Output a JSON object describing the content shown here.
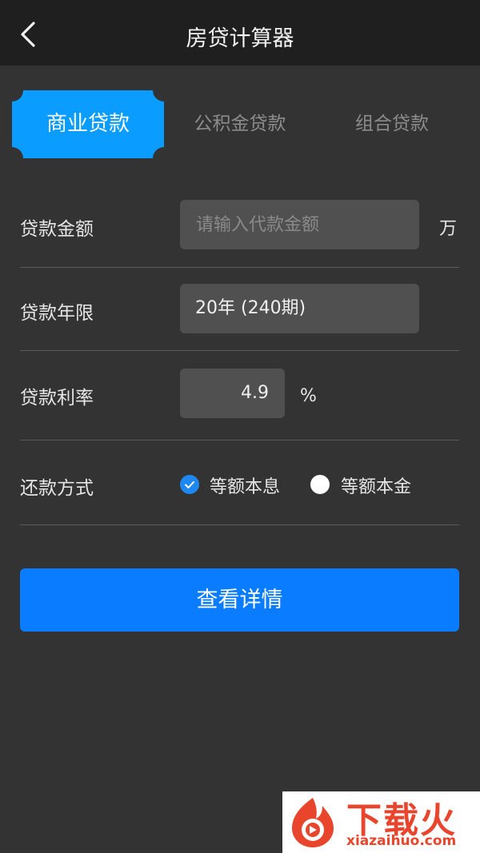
{
  "header": {
    "title": "房贷计算器",
    "back_icon": "chevron-left-icon"
  },
  "tabs": [
    {
      "label": "商业贷款",
      "active": true
    },
    {
      "label": "公积金贷款",
      "active": false
    },
    {
      "label": "组合贷款",
      "active": false
    }
  ],
  "form": {
    "amount": {
      "label": "贷款金额",
      "placeholder": "请输入代款金额",
      "value": "",
      "unit": "万"
    },
    "term": {
      "label": "贷款年限",
      "value": "20年 (240期)"
    },
    "rate": {
      "label": "贷款利率",
      "value": "4.9",
      "unit": "%"
    },
    "method": {
      "label": "还款方式",
      "options": [
        {
          "label": "等额本息",
          "checked": true
        },
        {
          "label": "等额本金",
          "checked": false
        }
      ]
    }
  },
  "submit_label": "查看详情",
  "watermark": {
    "title": "下载火",
    "subtitle": "xiazaihuo.com"
  },
  "colors": {
    "accent": "#0a7cff",
    "tab_active": "#0a9cff",
    "background": "#333333",
    "header": "#1f1f1f",
    "field": "#505050"
  }
}
